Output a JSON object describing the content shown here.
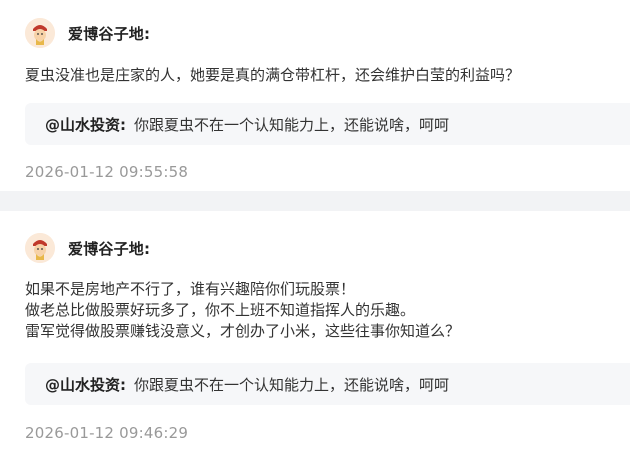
{
  "comments": [
    {
      "author": "爱博谷子地:",
      "lines": [
        "夏虫没准也是庄家的人，她要是真的满仓带杠杆，还会维护白莹的利益吗？"
      ],
      "reply_user": "@山水投资:",
      "reply_text": "你跟夏虫不在一个认知能力上，还能说啥，呵呵",
      "time": "2026-01-12 09:55:58"
    },
    {
      "author": "爱博谷子地:",
      "lines": [
        "如果不是房地产不行了，谁有兴趣陪你们玩股票！",
        "做老总比做股票好玩多了，你不上班不知道指挥人的乐趣。",
        "雷军觉得做股票赚钱没意义，才创办了小米，这些往事你知道么？"
      ],
      "reply_user": "@山水投资:",
      "reply_text": "你跟夏虫不在一个认知能力上，还能说啥，呵呵",
      "time": "2026-01-12 09:46:29"
    }
  ]
}
